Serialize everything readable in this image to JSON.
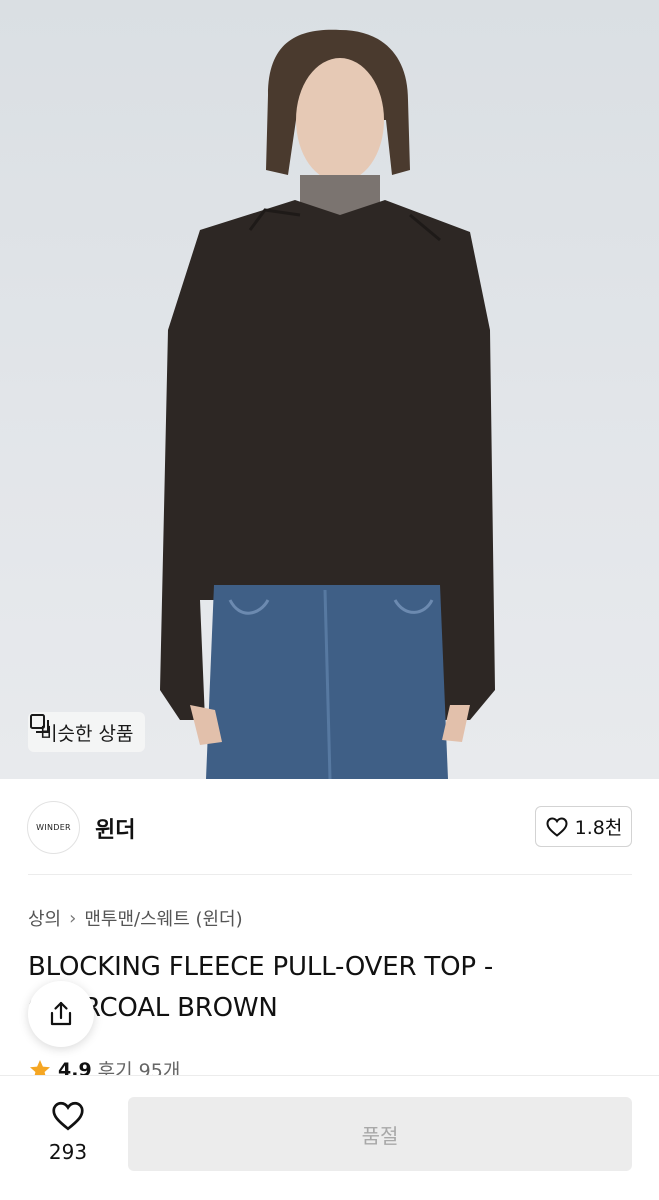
{
  "hero": {
    "similar_label": "비슷한 상품"
  },
  "brand": {
    "logo_text": "WINDER",
    "name": "윈더",
    "like_count": "1.8천"
  },
  "breadcrumb": {
    "category": "상의",
    "subcategory": "맨투맨/스웨트 (윈더)"
  },
  "product": {
    "title": "BLOCKING FLEECE PULL-OVER TOP - CHARCOAL BROWN"
  },
  "rating": {
    "score": "4.9",
    "reviews": "후기 95개"
  },
  "bottom_bar": {
    "wish_count": "293",
    "buy_label": "품절"
  },
  "colors": {
    "star": "#f5a623",
    "sweater": "#2d2724",
    "jeans": "#3f5f86",
    "soldout_bg": "#ececec"
  }
}
